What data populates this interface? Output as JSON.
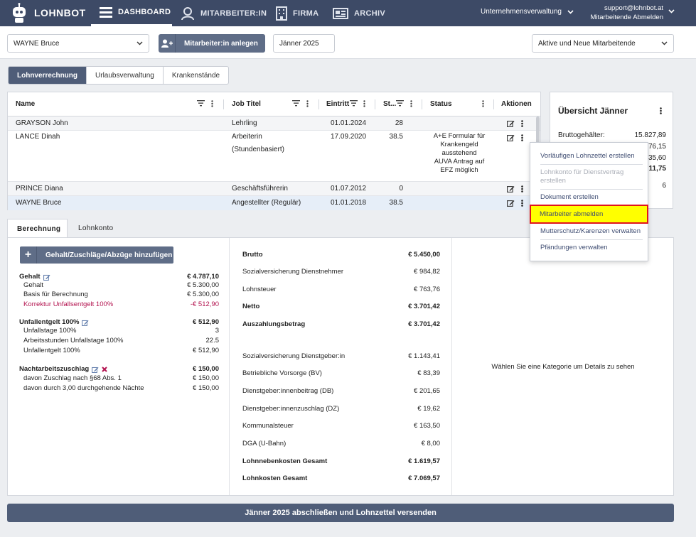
{
  "nav": {
    "brand": "LOHNBOT",
    "items": [
      {
        "label": "DASHBOARD",
        "icon": "hamburger-icon",
        "active": true
      },
      {
        "label": "MITARBEITER:IN",
        "icon": "user-icon",
        "active": false
      },
      {
        "label": "FIRMA",
        "icon": "building-icon",
        "active": false
      },
      {
        "label": "ARCHIV",
        "icon": "archive-icon",
        "active": false
      }
    ],
    "tenant": "Unternehmensverwaltung",
    "user_email": "support@lohnbot.at",
    "user_sub": "Mitarbeitende Abmelden"
  },
  "toolbar": {
    "employee_select": "WAYNE Bruce",
    "add_employee": "Mitarbeiter:in anlegen",
    "period": "Jänner 2025",
    "filter_select": "Aktive und Neue Mitarbeitende"
  },
  "tabs": [
    "Lohnverrechnung",
    "Urlaubsverwaltung",
    "Krankenstände"
  ],
  "table": {
    "headers": {
      "name": "Name",
      "job": "Job Titel",
      "entry": "Eintritt",
      "st": "St...",
      "status": "Status",
      "actions": "Aktionen"
    },
    "rows": [
      {
        "name": "GRAYSON John",
        "job": "Lehrling",
        "entry": "01.01.2024",
        "st": "28",
        "status": ""
      },
      {
        "name": "LANCE Dinah",
        "job": "Arbeiterin",
        "job2": "(Stundenbasiert)",
        "entry": "17.09.2020",
        "st": "38.5",
        "status_lines": [
          "A+E Formular für",
          "Krankengeld",
          "ausstehend",
          "AUVA Antrag auf",
          "EFZ möglich"
        ]
      },
      {
        "name": "PRINCE Diana",
        "job": "Geschäftsführerin",
        "entry": "01.07.2012",
        "st": "0",
        "status": ""
      },
      {
        "name": "WAYNE Bruce",
        "job": "Angestellter (Regulär)",
        "entry": "01.01.2018",
        "st": "38.5",
        "status": ""
      }
    ]
  },
  "overview": {
    "title": "Übersicht Jänner",
    "rows": [
      {
        "label": "Bruttogehälter:",
        "value": "15.827,89"
      },
      {
        "label": "",
        "value": "76,15"
      },
      {
        "label": "",
        "value": "35,60"
      },
      {
        "label": "",
        "value": "11,75"
      },
      {
        "label": "",
        "value": "6"
      }
    ]
  },
  "context_menu": {
    "items": [
      {
        "label": "Vorläufigen Lohnzettel erstellen",
        "disabled": false
      },
      {
        "label": "Lohnkonto für Dienstvertrag erstellen",
        "disabled": true
      },
      {
        "label": "Dokument erstellen",
        "disabled": false
      },
      {
        "label": "Mitarbeiter abmelden",
        "disabled": false,
        "highlighted": true
      },
      {
        "label": "Mutterschutz/Karenzen verwalten",
        "disabled": false
      },
      {
        "label": "Pfändungen verwalten",
        "disabled": false
      }
    ]
  },
  "lower_tabs": [
    "Berechnung",
    "Lohnkonto"
  ],
  "calc": {
    "add_button": "Gehalt/Zuschläge/Abzüge hinzufügen",
    "gehalt": {
      "label": "Gehalt",
      "value": "€ 4.787,10",
      "lines": [
        {
          "label": "Gehalt",
          "value": "€ 5.300,00"
        },
        {
          "label": "Basis für Berechnung",
          "value": "€ 5.300,00"
        },
        {
          "label": "Korrektur Unfallsentgelt 100%",
          "value": "-€ 512,90"
        }
      ]
    },
    "unfall": {
      "label": "Unfallentgelt 100%",
      "value": "€ 512,90",
      "lines": [
        {
          "label": "Unfallstage 100%",
          "value": "3"
        },
        {
          "label": "Arbeitsstunden Unfallstage 100%",
          "value": "22.5"
        },
        {
          "label": "Unfallentgelt 100%",
          "value": "€ 512,90"
        }
      ]
    },
    "nacht": {
      "label": "Nachtarbeitszuschlag",
      "value": "€ 150,00",
      "lines": [
        {
          "label": "davon Zuschlag nach §68 Abs. 1",
          "value": "€ 150,00"
        },
        {
          "label": "davon durch 3,00 durchgehende Nächte",
          "value": "€ 150,00"
        }
      ]
    }
  },
  "summary": [
    {
      "label": "Brutto",
      "value": "€ 5.450,00",
      "bold": true
    },
    {
      "label": "Sozialversicherung Dienstnehmer",
      "value": "€ 984,82",
      "bold": false
    },
    {
      "label": "Lohnsteuer",
      "value": "€ 763,76",
      "bold": false
    },
    {
      "label": "Netto",
      "value": "€ 3.701,42",
      "bold": true
    },
    {
      "label": "Auszahlungsbetrag",
      "value": "€ 3.701,42",
      "bold": true
    },
    {
      "label": "Sozialversicherung Dienstgeber:in",
      "value": "€ 1.143,41",
      "bold": false
    },
    {
      "label": "Betriebliche Vorsorge (BV)",
      "value": "€ 83,39",
      "bold": false
    },
    {
      "label": "Dienstgeber:innenbeitrag (DB)",
      "value": "€ 201,65",
      "bold": false
    },
    {
      "label": "Dienstgeber:innenzuschlag (DZ)",
      "value": "€ 19,62",
      "bold": false
    },
    {
      "label": "Kommunalsteuer",
      "value": "€ 163,50",
      "bold": false
    },
    {
      "label": "DGA (U-Bahn)",
      "value": "€ 8,00",
      "bold": false
    },
    {
      "label": "Lohnnebenkosten Gesamt",
      "value": "€ 1.619,57",
      "bold": true
    },
    {
      "label": "Lohnkosten Gesamt",
      "value": "€ 7.069,57",
      "bold": true
    }
  ],
  "detail_hint": "Wählen Sie eine Kategorie um Details zu sehen",
  "finish_button": "Jänner 2025 abschließen und Lohnzettel versenden",
  "colors": {
    "nav": "#3d4a66",
    "primary": "#5f6d87",
    "highlight": "#ffff00",
    "highlight_border": "#e0141e",
    "link": "#3f4d72",
    "danger": "#b3134f"
  }
}
